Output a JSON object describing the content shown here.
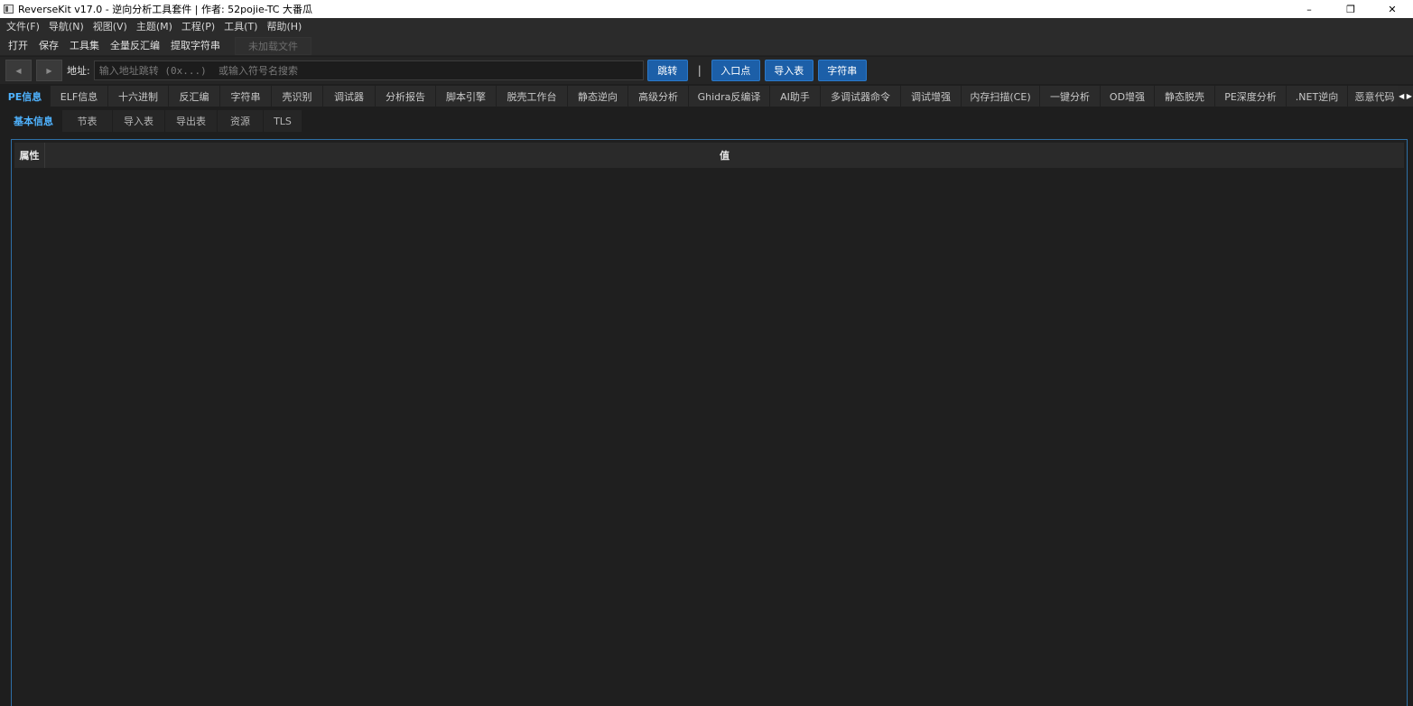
{
  "window": {
    "title": "ReverseKit v17.0 - 逆向分析工具套件 | 作者: 52pojie-TC 大番瓜",
    "controls": {
      "minimize": "–",
      "restore": "❐",
      "close": "✕"
    }
  },
  "menu": [
    "文件(F)",
    "导航(N)",
    "视图(V)",
    "主题(M)",
    "工程(P)",
    "工具(T)",
    "帮助(H)"
  ],
  "toolbar": {
    "buttons": [
      "打开",
      "保存",
      "工具集",
      "全量反汇编",
      "提取字符串"
    ],
    "status": "未加载文件"
  },
  "address": {
    "back": "◀",
    "forward": "▶",
    "label": "地址:",
    "placeholder": "输入地址跳转 (0x...)  或输入符号名搜索",
    "value": "",
    "go": "跳转",
    "separator": "|",
    "entry": "入口点",
    "imports": "导入表",
    "strings": "字符串"
  },
  "tabs": [
    "PE信息",
    "ELF信息",
    "十六进制",
    "反汇编",
    "字符串",
    "壳识别",
    "调试器",
    "分析报告",
    "脚本引擎",
    "脱壳工作台",
    "静态逆向",
    "高级分析",
    "Ghidra反编译",
    "AI助手",
    "多调试器命令",
    "调试增强",
    "内存扫描(CE)",
    "一键分析",
    "OD增强",
    "静态脱壳",
    "PE深度分析",
    ".NET逆向",
    "恶意代码"
  ],
  "tab_scroll": "◀ ▶",
  "subtabs": [
    "基本信息",
    "节表",
    "导入表",
    "导出表",
    "资源",
    "TLS"
  ],
  "table": {
    "columns": [
      "属性",
      "值"
    ],
    "rows": []
  },
  "colors": {
    "accent": "#4fb3ff",
    "button_blue": "#1c5fa8",
    "panel_border": "#2e6fa6",
    "background": "#1e1e1e"
  }
}
